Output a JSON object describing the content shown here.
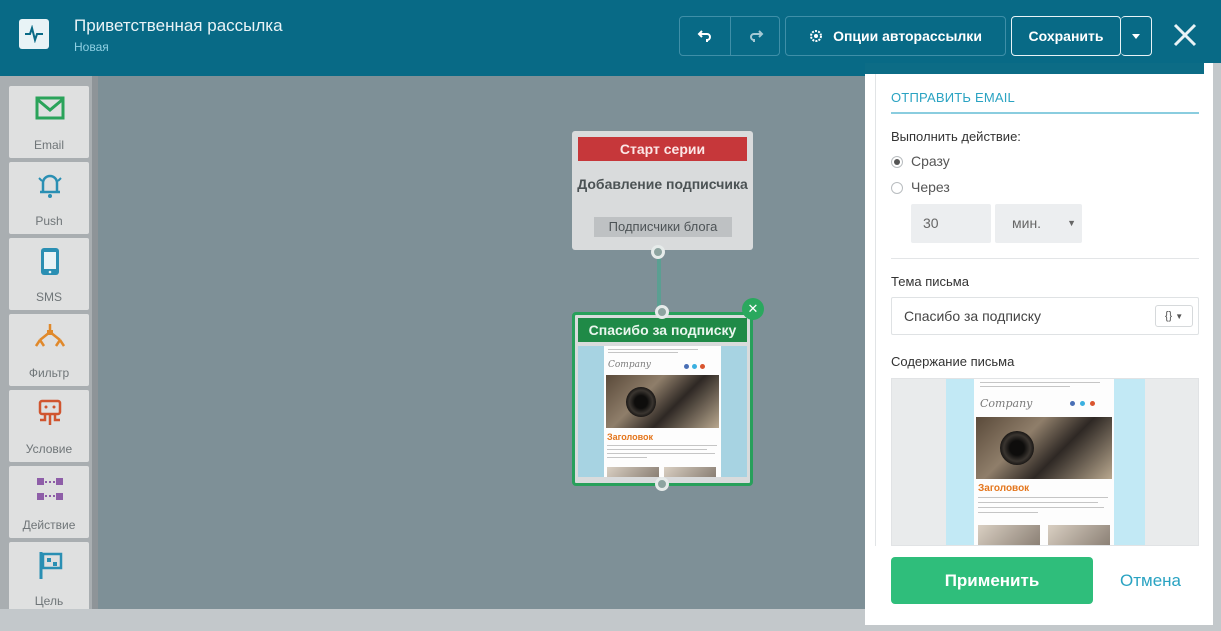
{
  "header": {
    "title": "Приветственная рассылка",
    "subtitle": "Новая",
    "options_label": "Опции авторассылки",
    "save_label": "Сохранить"
  },
  "sidebar": {
    "tools": [
      {
        "label": "Email",
        "icon": "email-icon",
        "color": "#2aa35a"
      },
      {
        "label": "Push",
        "icon": "bell-icon",
        "color": "#2a8fb3"
      },
      {
        "label": "SMS",
        "icon": "phone-icon",
        "color": "#2a8fb3"
      },
      {
        "label": "Фильтр",
        "icon": "filter-icon",
        "color": "#e0892b"
      },
      {
        "label": "Условие",
        "icon": "condition-icon",
        "color": "#d0552f"
      },
      {
        "label": "Действие",
        "icon": "action-icon",
        "color": "#8e5ea8"
      },
      {
        "label": "Цель",
        "icon": "flag-icon",
        "color": "#2a8fb3"
      }
    ]
  },
  "canvas": {
    "start_node": {
      "bar_label": "Старт серии",
      "name": "Добавление подписчика",
      "tag": "Подписчики блога"
    },
    "email_node": {
      "bar_label": "Спасибо за подписку"
    }
  },
  "email_preview": {
    "brand": "Company",
    "heading": "Заголовок"
  },
  "panel": {
    "title": "ОТПРАВИТЬ EMAIL",
    "action_label": "Выполнить действие:",
    "option_now": "Сразу",
    "option_delay": "Через",
    "delay_value": "30",
    "delay_unit": "мин.",
    "subject_label": "Тема письма",
    "subject_value": "Спасибо за подписку",
    "var_button": "{}",
    "content_label": "Содержание письма",
    "apply_label": "Применить",
    "cancel_label": "Отмена"
  },
  "colors": {
    "header_bg": "#086a86",
    "start_red": "#c6373a",
    "email_green": "#1f8a47",
    "accent_teal": "#2aa3c2",
    "apply_green": "#2fbe7b"
  }
}
